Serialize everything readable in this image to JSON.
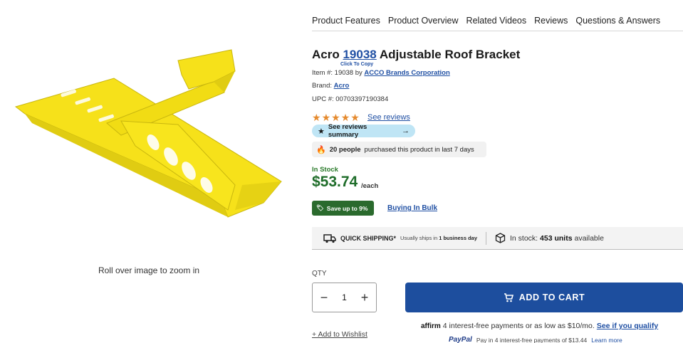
{
  "tabs": [
    "Product Features",
    "Product Overview",
    "Related Videos",
    "Reviews",
    "Questions & Answers"
  ],
  "image": {
    "zoom_hint": "Roll over image to zoom in",
    "icon": "yellow-roof-bracket"
  },
  "product": {
    "brand_word": "Acro",
    "model_number": "19038",
    "title_rest": "Adjustable Roof Bracket",
    "copy_hint": "Click To Copy",
    "item_prefix": "Item #: 19038 by",
    "item_brand_link": "ACCO Brands Corporation",
    "brand_label": "Brand:",
    "brand_link": "Acro",
    "upc": "UPC #: 00703397190384"
  },
  "reviews": {
    "stars": [
      "★",
      "★",
      "★",
      "★",
      "★"
    ],
    "link": "See reviews",
    "summary_label": "See reviews summary"
  },
  "purchased": {
    "count": "20 people",
    "text": "purchased this product in last 7 days"
  },
  "stock": {
    "status": "In Stock",
    "price": "$53.74",
    "per": "/each",
    "save_badge": "Save up to 9%",
    "bulk_link": "Buying In Bulk"
  },
  "shipping": {
    "label": "QUICK SHIPPING*",
    "sub_prefix": "Usually ships in",
    "sub_bold": "1 business day",
    "stock_prefix": "In stock:",
    "stock_units": "453 units",
    "stock_suffix": "available"
  },
  "cart": {
    "qty_label": "QTY",
    "qty_value": "1",
    "minus": "−",
    "plus": "+",
    "add_to_cart": "ADD TO CART",
    "wishlist": "+ Add to Wishlist"
  },
  "financing": {
    "affirm_logo": "affirm",
    "affirm_text": "4 interest-free payments or as low as $10/mo.",
    "affirm_link": "See if you qualify",
    "paypal_logo": "PayPal",
    "paypal_text": "Pay in 4 interest-free payments of $13.44",
    "paypal_link": "Learn more"
  },
  "colors": {
    "link_blue": "#1f4fa3",
    "cart_blue": "#1d4e9e",
    "price_green": "#1f6d2a",
    "save_green": "#2a6a2d",
    "star_orange": "#e58a2e",
    "pill_blue": "#bfe5f5",
    "bracket_yellow": "#f7e31a"
  }
}
